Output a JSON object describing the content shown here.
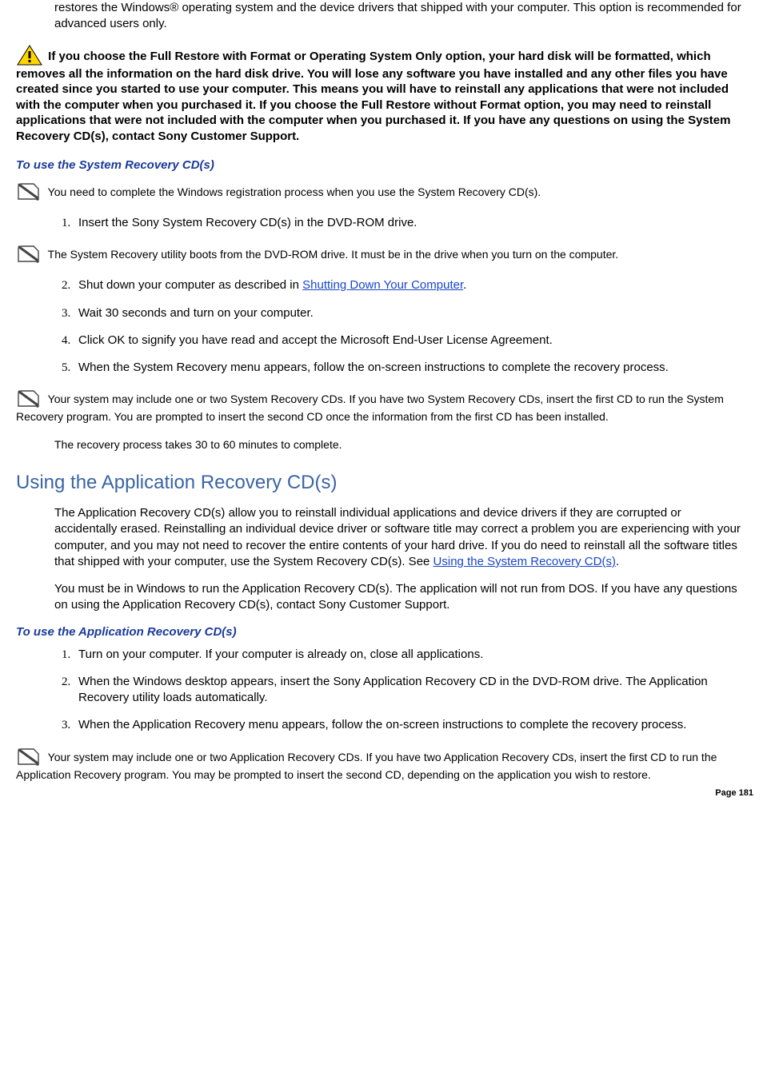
{
  "intro_text": "restores the Windows® operating system and the device drivers that shipped with your computer. This option is recommended for advanced users only.",
  "warning_text": "If you choose the Full Restore with Format or Operating System Only option, your hard disk will be formatted, which removes all the information on the hard disk drive. You will lose any software you have installed and any other files you have created since you started to use your computer. This means you will have to reinstall any applications that were not included with the computer when you purchased it. If you choose the Full Restore without Format option, you may need to reinstall applications that were not included with the computer when you purchased it. If you have any questions on using the System Recovery CD(s), contact Sony Customer Support.",
  "sys_recovery": {
    "heading": "To use the System Recovery CD(s)",
    "note1": "You need to complete the Windows registration process when you use the System Recovery CD(s).",
    "step1": "Insert the Sony System Recovery CD(s) in the DVD-ROM drive.",
    "note2": "The System Recovery utility boots from the DVD-ROM drive. It must be in the drive when you turn on the computer.",
    "step2_pre": "Shut down your computer as described in ",
    "step2_link": "Shutting Down Your Computer",
    "step2_post": ".",
    "step3": "Wait 30 seconds and turn on your computer.",
    "step4": "Click OK to signify you have read and accept the Microsoft End-User License Agreement.",
    "step5": "When the System Recovery menu appears, follow the on-screen instructions to complete the recovery process.",
    "note3": "Your system may include one or two System Recovery CDs. If you have two System Recovery CDs, insert the first CD to run the System Recovery program. You are prompted to insert the second CD once the information from the first CD has been installed.",
    "note4": "The recovery process takes 30 to 60 minutes to complete."
  },
  "app_recovery": {
    "heading": "Using the Application Recovery CD(s)",
    "para1_pre": "The Application Recovery CD(s) allow you to reinstall individual applications and device drivers if they are corrupted or accidentally erased. Reinstalling an individual device driver or software title may correct a problem you are experiencing with your computer, and you may not need to recover the entire contents of your hard drive. If you do need to reinstall all the software titles that shipped with your computer, use the System Recovery CD(s). See ",
    "para1_link": "Using the System Recovery CD(s)",
    "para1_post": ".",
    "para2": "You must be in Windows to run the Application Recovery CD(s). The application will not run from DOS. If you have any questions on using the Application Recovery CD(s), contact Sony Customer Support.",
    "subhead": "To use the Application Recovery CD(s)",
    "step1": "Turn on your computer. If your computer is already on, close all applications.",
    "step2": "When the Windows desktop appears, insert the Sony Application Recovery CD in the DVD-ROM drive. The Application Recovery utility loads automatically.",
    "step3": "When the Application Recovery menu appears, follow the on-screen instructions to complete the recovery process.",
    "note": "Your system may include one or two Application Recovery CDs. If you have two Application Recovery CDs, insert the first CD to run the Application Recovery program. You may be prompted to insert the second CD, depending on the application you wish to restore."
  },
  "page_label": "Page 181"
}
